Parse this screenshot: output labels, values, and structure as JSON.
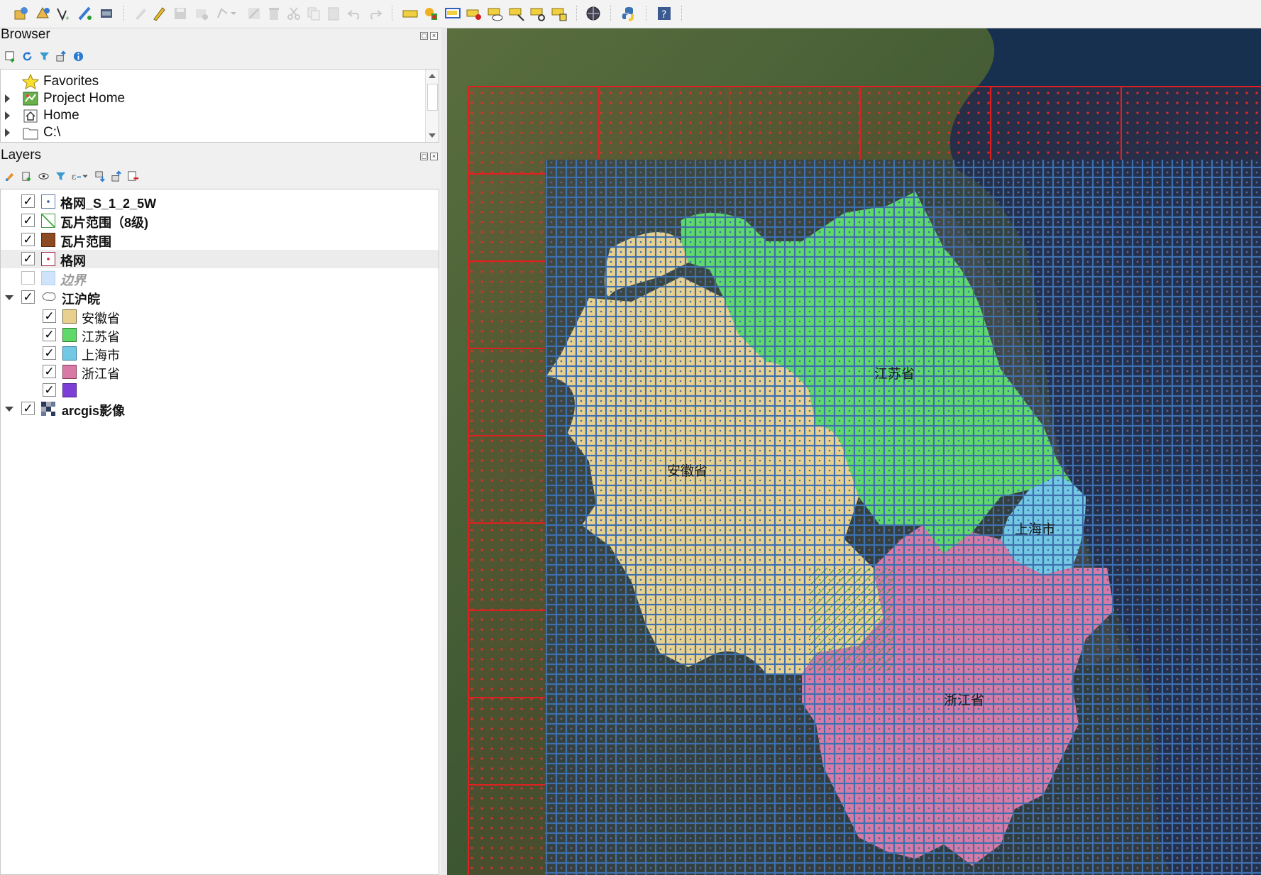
{
  "panels": {
    "browser": {
      "title": "Browser",
      "items": [
        {
          "label": "Favorites",
          "icon": "star-icon",
          "expandable": false
        },
        {
          "label": "Project Home",
          "icon": "project-home-icon",
          "expandable": true
        },
        {
          "label": "Home",
          "icon": "home-icon",
          "expandable": true
        },
        {
          "label": "C:\\",
          "icon": "folder-icon",
          "expandable": true
        }
      ]
    },
    "layers": {
      "title": "Layers",
      "items": [
        {
          "label": "格网_S_1_2_5W",
          "checked": true,
          "symbol": "point-grid-symbol",
          "style": "bold"
        },
        {
          "label": "瓦片范围（8级)",
          "checked": true,
          "symbol": "hatch-polygon-symbol",
          "style": "bold"
        },
        {
          "label": "瓦片范围",
          "checked": true,
          "symbol": "brown-fill-symbol",
          "color": "#8b4a22",
          "style": "bold"
        },
        {
          "label": "格网",
          "checked": true,
          "symbol": "red-point-grid-symbol",
          "style": "bold",
          "selected": true
        },
        {
          "label": "边界",
          "checked": false,
          "symbol": "light-blue-fill-symbol",
          "color": "#cfe4fb",
          "style": "ghost"
        },
        {
          "label": "江沪皖",
          "checked": true,
          "symbol": "polygon-group-symbol",
          "style": "bold",
          "group": true
        },
        {
          "label": "安徽省",
          "checked": true,
          "symbol": "fill-symbol",
          "color": "#e8d18e",
          "child": true
        },
        {
          "label": "江苏省",
          "checked": true,
          "symbol": "fill-symbol",
          "color": "#5fd96a",
          "child": true
        },
        {
          "label": "上海市",
          "checked": true,
          "symbol": "fill-symbol",
          "color": "#73c9e3",
          "child": true
        },
        {
          "label": "浙江省",
          "checked": true,
          "symbol": "fill-symbol",
          "color": "#d77aa5",
          "child": true
        },
        {
          "label": "",
          "checked": true,
          "symbol": "fill-symbol",
          "color": "#7b3fd6",
          "child": true
        },
        {
          "label": "arcgis影像",
          "checked": true,
          "symbol": "raster-symbol",
          "style": "bold",
          "group": true
        }
      ]
    }
  },
  "map": {
    "labels": {
      "anhui": "安徽省",
      "jiangsu": "江苏省",
      "shanghai": "上海市",
      "zhejiang": "浙江省"
    },
    "colors": {
      "anhui": "#e8d18e",
      "jiangsu": "#5fd96a",
      "shanghai": "#73c9e3",
      "zhejiang": "#d77aa5",
      "grid_line": "#3f6fae",
      "tile_line": "#e02020",
      "tile_dot": "#ff2a2a",
      "sea": "#17304f"
    }
  }
}
